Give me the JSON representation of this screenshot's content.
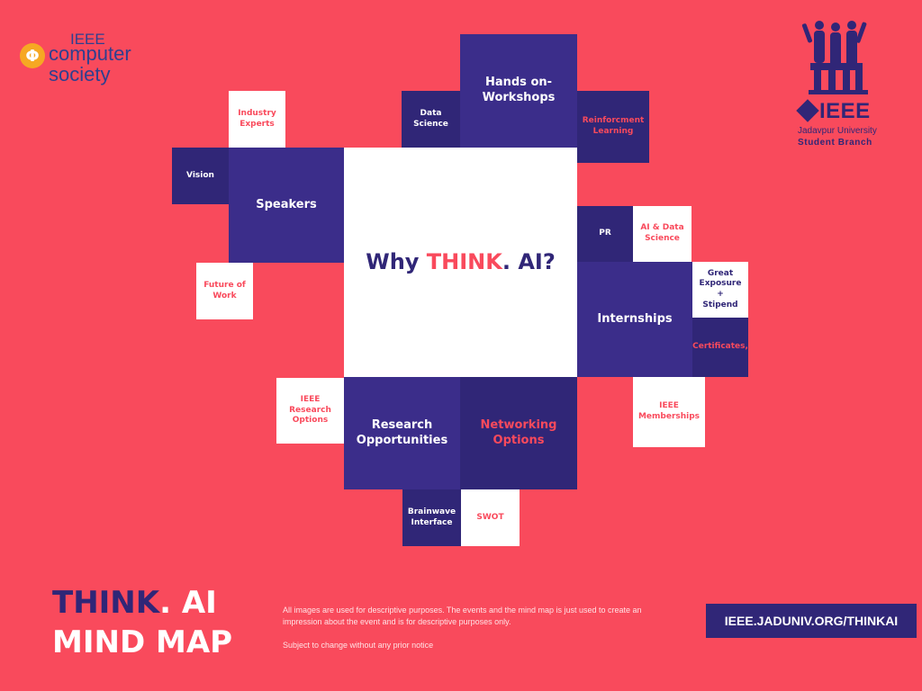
{
  "logos": {
    "computer_society": {
      "top": "IEEE",
      "line1": "computer",
      "line2": "society",
      "symbol": "Φ"
    },
    "ju_branch": {
      "word": "IEEE",
      "university": "Jadavpur University",
      "branch": "Student Branch"
    }
  },
  "center": {
    "prefix": "Why ",
    "highlight": "THINK",
    "suffix": ". AI?"
  },
  "nodes": {
    "hands_on": "Hands on-\nWorkshops",
    "data_science": "Data\nScience",
    "reinforcement": "Reinforcment\nLearning",
    "industry_experts": "Industry\nExperts",
    "vision": "Vision",
    "speakers": "Speakers",
    "future_of_work": "Future of\nWork",
    "pr": "PR",
    "ai_data_science": "AI & Data\nScience",
    "great_exposure": "Great\nExposure +\nStipend",
    "internships": "Internships",
    "certificates": "Certificates,",
    "ieee_memberships": "IEEE\nMemberships",
    "ieee_research": "IEEE\nResearch\nOptions",
    "research_opps": "Research\nOpportunities",
    "networking": "Networking\nOptions",
    "brainwave": "Brainwave\nInterface",
    "swot": "SWOT"
  },
  "footer": {
    "title_think": "THINK",
    "title_ai": ". AI",
    "title_line2": "MIND MAP",
    "disclaimer": "All images are used for descriptive purposes. The events and the mind map is just used to create an impression about the event and is for descriptive purposes only.",
    "note": "Subject to change without any prior notice",
    "url": "IEEE.JADUNIV.ORG/THINKAI"
  },
  "colors": {
    "background": "#f94a5c",
    "purple": "#3b2d8a",
    "navy": "#302677",
    "white": "#ffffff"
  }
}
